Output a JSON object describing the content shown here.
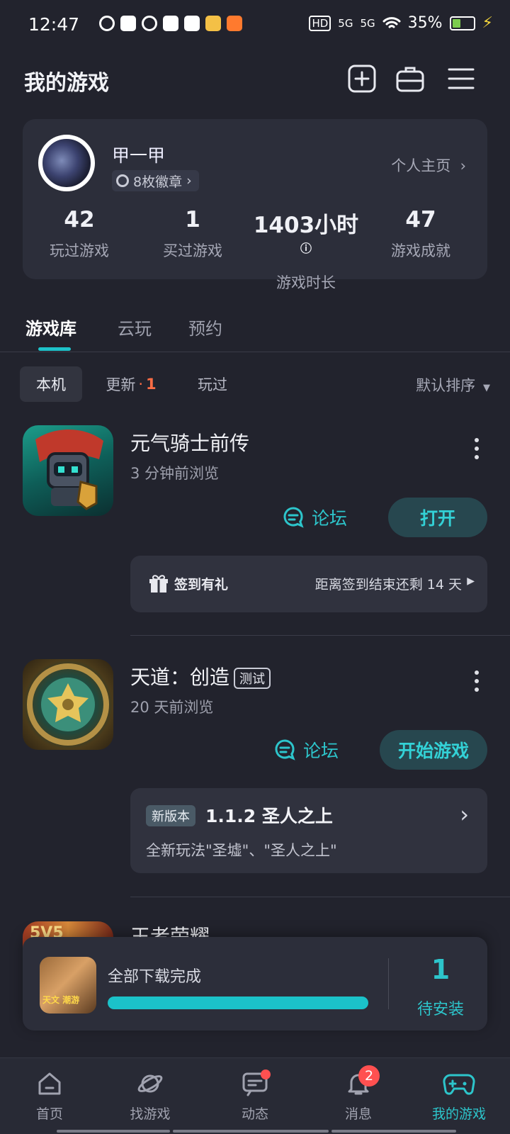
{
  "status_bar": {
    "time": "12:47",
    "network_labels": [
      "HD",
      "5G",
      "5G"
    ],
    "battery": "35%"
  },
  "header": {
    "title": "我的游戏"
  },
  "profile": {
    "username": "甲一甲",
    "badges": "8枚徽章",
    "home_link": "个人主页",
    "stats": [
      {
        "value": "42",
        "label": "玩过游戏"
      },
      {
        "value": "1",
        "label": "买过游戏"
      },
      {
        "value": "1403小时",
        "label": "游戏时长"
      },
      {
        "value": "47",
        "label": "游戏成就"
      }
    ]
  },
  "tabs": [
    "游戏库",
    "云玩",
    "预约"
  ],
  "filters": {
    "items": [
      "本机",
      "更新",
      "玩过"
    ],
    "update_dot": "·",
    "update_count": "1",
    "sort": "默认排序"
  },
  "games": [
    {
      "name": "元气骑士前传",
      "viewed": "3 分钟前浏览",
      "forum": "论坛",
      "action": "打开",
      "panel": {
        "left": "签到有礼",
        "right": "距离签到结束还剩 14 天"
      }
    },
    {
      "name": "天道：创造",
      "tag": "测试",
      "viewed": "20 天前浏览",
      "forum": "论坛",
      "action": "开始游戏",
      "panel": {
        "badge": "新版本",
        "title": "1.1.2 圣人之上",
        "desc": "全新玩法\"圣墟\"、\"圣人之上\""
      }
    },
    {
      "name": "王者荣耀",
      "icon_text": "5V5"
    }
  ],
  "download": {
    "status": "全部下载完成",
    "progress": 1.0,
    "count": "1",
    "count_label": "待安装",
    "icon_text": "天文 潮游"
  },
  "nav": {
    "items": [
      "首页",
      "找游戏",
      "动态",
      "消息",
      "我的游戏"
    ],
    "message_badge": "2"
  },
  "colors": {
    "accent": "#2dc5cb",
    "background": "#22232d",
    "card": "#2c2e3a",
    "badge_red": "#ff5050"
  }
}
